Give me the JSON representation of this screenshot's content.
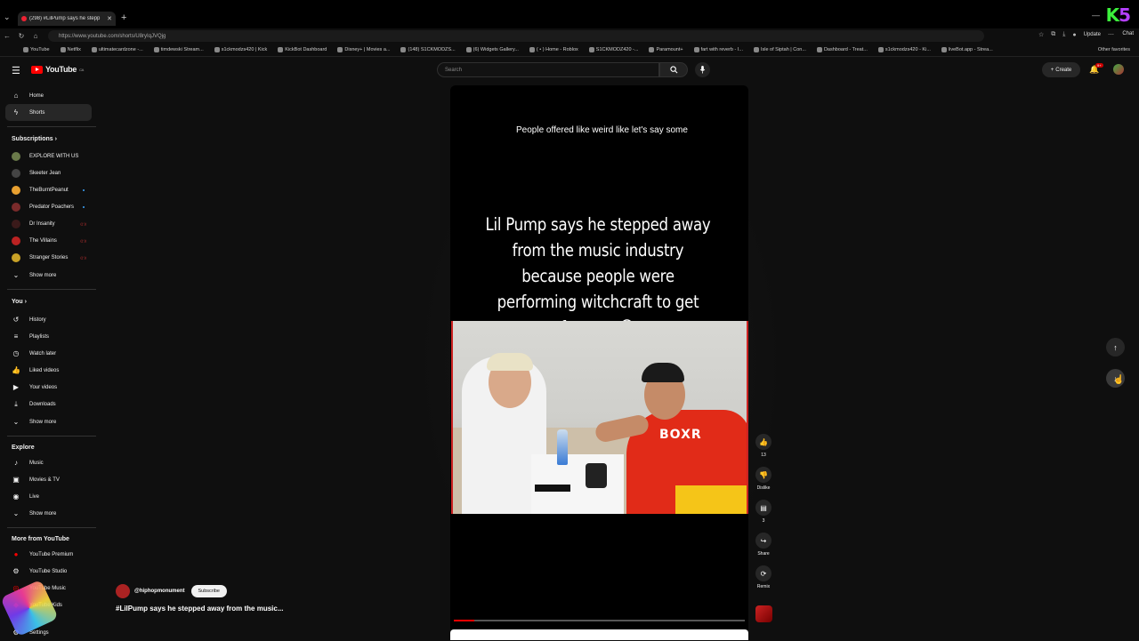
{
  "browser": {
    "tab_title": "(298) #LilPump says he stepp",
    "url": "https://www.youtube.com/shorts/U8ryIqJVQjg",
    "update_label": "Update",
    "chat_label": "Chat",
    "overlay_brand": {
      "k": "K",
      "five": "5",
      "colors": {
        "k": "#3cf03c",
        "five": "#b540ff"
      }
    },
    "bookmarks": [
      {
        "label": "YouTube"
      },
      {
        "label": "Netflix"
      },
      {
        "label": "ultimatecardzone -..."
      },
      {
        "label": "timdewski Stream..."
      },
      {
        "label": "s1ckmodzs420 | Kick"
      },
      {
        "label": "KickBot Dashboard"
      },
      {
        "label": "Disney+ | Movies a..."
      },
      {
        "label": "(148) S1CKMODZS..."
      },
      {
        "label": "(6) Widgets Gallery..."
      },
      {
        "label": "( • ) Home - Roblox"
      },
      {
        "label": "S1CKMODZ420 -..."
      },
      {
        "label": "Paramount+"
      },
      {
        "label": "fart with reverb - I..."
      },
      {
        "label": "Isle of Siptah | Con..."
      },
      {
        "label": "Dashboard - Treat..."
      },
      {
        "label": "s1ckmodzs420 - Ki..."
      },
      {
        "label": "liveBot.app - Strea..."
      }
    ],
    "other_favorites": "Other favorites"
  },
  "header": {
    "logo_text": "YouTube",
    "logo_country": "CA",
    "search_placeholder": "Search",
    "create_label": "Create",
    "notification_count": "9+",
    "brand_color": "#ff0000"
  },
  "sidebar": {
    "main": [
      {
        "label": "Home",
        "icon": "home-icon"
      },
      {
        "label": "Shorts",
        "icon": "shorts-icon",
        "active": true
      }
    ],
    "subscriptions_heading": "Subscriptions",
    "subscriptions": [
      {
        "label": "EXPLORE WITH US",
        "color": "#6a7a4a"
      },
      {
        "label": "Skeeter Jean",
        "color": "#444"
      },
      {
        "label": "TheBurntPeanut",
        "color": "#e8a030",
        "dot": "new"
      },
      {
        "label": "Predator Poachers",
        "color": "#7a2b2b",
        "dot": "new"
      },
      {
        "label": "Dr Insanity",
        "color": "#3a1a1a",
        "dot": "live"
      },
      {
        "label": "The Villains",
        "color": "#b22",
        "dot": "live"
      },
      {
        "label": "Stranger Stories",
        "color": "#c9a227",
        "dot": "live"
      }
    ],
    "subs_show_more": "Show more",
    "you_heading": "You",
    "you_items": [
      {
        "label": "History",
        "icon": "history-icon"
      },
      {
        "label": "Playlists",
        "icon": "playlists-icon"
      },
      {
        "label": "Watch later",
        "icon": "watch-later-icon"
      },
      {
        "label": "Liked videos",
        "icon": "liked-videos-icon"
      },
      {
        "label": "Your videos",
        "icon": "your-videos-icon"
      },
      {
        "label": "Downloads",
        "icon": "downloads-icon"
      }
    ],
    "you_show_more": "Show more",
    "explore_heading": "Explore",
    "explore_items": [
      {
        "label": "Music",
        "icon": "music-icon"
      },
      {
        "label": "Movies & TV",
        "icon": "movies-icon"
      },
      {
        "label": "Live",
        "icon": "live-icon"
      }
    ],
    "explore_show_more": "Show more",
    "more_heading": "More from YouTube",
    "more_items": [
      {
        "label": "YouTube Premium",
        "icon": "youtube-premium-icon"
      },
      {
        "label": "YouTube Studio",
        "icon": "youtube-studio-icon"
      },
      {
        "label": "YouTube Music",
        "icon": "youtube-music-icon"
      },
      {
        "label": "YouTube Kids",
        "icon": "youtube-kids-icon"
      }
    ],
    "settings_label": "Settings"
  },
  "short": {
    "caption": "People offered like weird like let's say some",
    "headline": "Lil Pump says he stepped away from the music industry because people were performing witchcraft to get famous 😭",
    "shirt_text": "BOXR",
    "channel": "@hiphopmonument",
    "subscribe_label": "Subscribe",
    "title": "#LilPump says he stepped away from the music...",
    "progress": 0.07
  },
  "actions": {
    "like_count": "13",
    "dislike_label": "Dislike",
    "comment_count": "3",
    "share_label": "Share",
    "remix_label": "Remix"
  }
}
